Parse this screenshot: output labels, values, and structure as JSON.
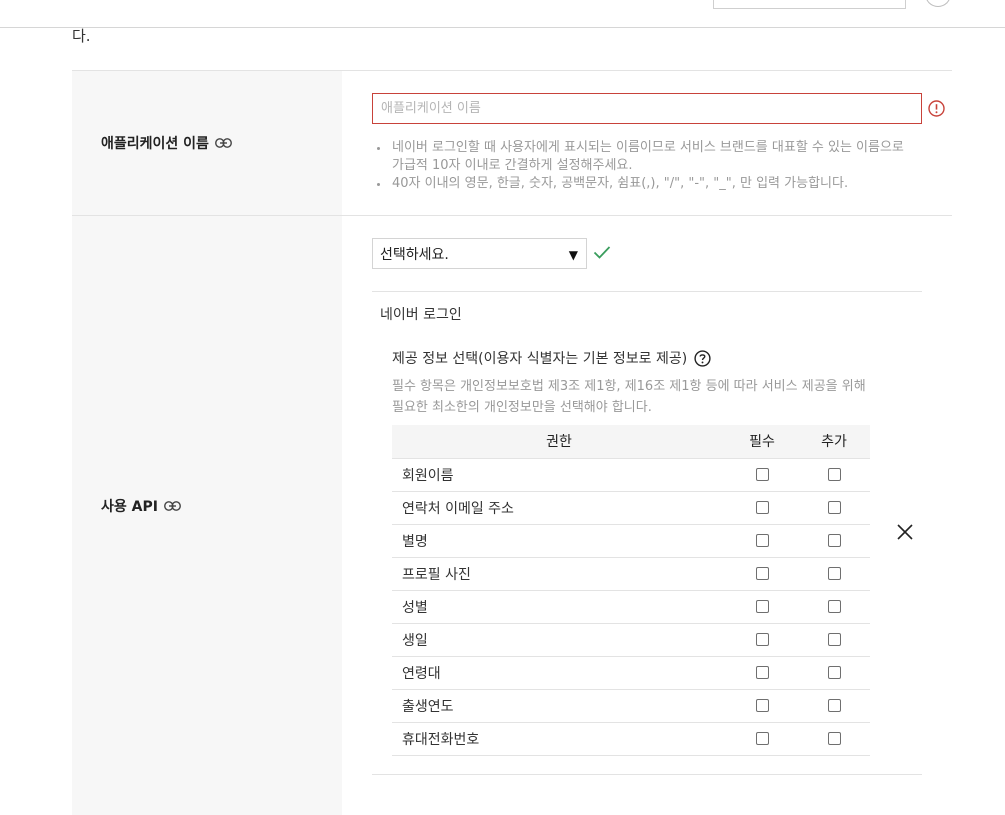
{
  "intro": {
    "tail": "다."
  },
  "app_name": {
    "label": "애플리케이션 이름",
    "placeholder": "애플리케이션 이름",
    "notes": [
      "네이버 로그인할 때 사용자에게 표시되는 이름이므로 서비스 브랜드를 대표할 수 있는 이름으로 가급적 10자 이내로 간결하게 설정해주세요.",
      "40자 이내의 영문, 한글, 숫자, 공백문자, 쉼표(,), \"/\", \"-\", \"_\", 만 입력 가능합니다."
    ],
    "error_color": "#c8423a"
  },
  "api": {
    "label": "사용 API",
    "select_value": "선택하세요.",
    "group_title": "네이버 로그인",
    "info_title": "제공 정보 선택(이용자 식별자는 기본 정보로 제공)",
    "info_desc": "필수 항목은 개인정보보호법 제3조 제1항, 제16조 제1항 등에 따라 서비스 제공을 위해 필요한 최소한의 개인정보만을 선택해야 합니다.",
    "table": {
      "headers": {
        "permission": "권한",
        "required": "필수",
        "optional": "추가"
      },
      "rows": [
        "회원이름",
        "연락처 이메일 주소",
        "별명",
        "프로필 사진",
        "성별",
        "생일",
        "연령대",
        "출생연도",
        "휴대전화번호"
      ]
    },
    "check_color": "#3a9d5d"
  }
}
